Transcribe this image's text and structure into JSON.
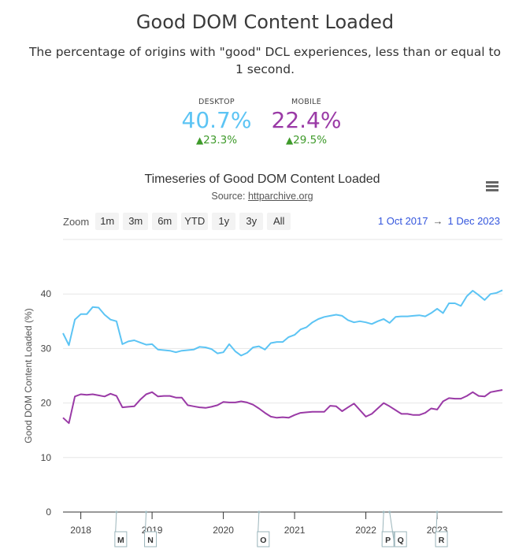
{
  "header": {
    "title": "Good DOM Content Loaded",
    "description": "The percentage of origins with \"good\" DCL experiences, less than or equal to 1 second."
  },
  "kpis": {
    "desktop": {
      "label": "DESKTOP",
      "value": "40.7%",
      "change": "23.3%",
      "change_direction": "up",
      "color": "#5cc4f4"
    },
    "mobile": {
      "label": "MOBILE",
      "value": "22.4%",
      "change": "29.5%",
      "change_direction": "up",
      "color": "#9a3aa6"
    }
  },
  "chart_header": {
    "title": "Timeseries of Good DOM Content Loaded",
    "source_prefix": "Source: ",
    "source_link": "httparchive.org",
    "menu_icon": "hamburger-menu-icon"
  },
  "zoom": {
    "label": "Zoom",
    "buttons": [
      "1m",
      "3m",
      "6m",
      "YTD",
      "1y",
      "3y",
      "All"
    ],
    "range_from": "1 Oct 2017",
    "range_arrow": "→",
    "range_to": "1 Dec 2023"
  },
  "chart_data": {
    "type": "line",
    "title": "Timeseries of Good DOM Content Loaded",
    "subtitle": "Source: httparchive.org",
    "xlabel": "",
    "ylabel": "Good DOM Content Loaded (%)",
    "ylim": [
      0,
      50
    ],
    "yticks": [
      0,
      10,
      20,
      30,
      40
    ],
    "x_start": "2017-10",
    "x_end": "2023-12",
    "x_interval": "monthly",
    "xticks": [
      "2018",
      "2019",
      "2020",
      "2021",
      "2022",
      "2023"
    ],
    "grid": true,
    "legend": "none",
    "series": [
      {
        "name": "Desktop",
        "color": "#5cc4f4",
        "values": [
          32.8,
          30.6,
          35.3,
          36.3,
          36.3,
          37.6,
          37.5,
          36.2,
          35.3,
          35.0,
          30.8,
          31.3,
          31.5,
          31.1,
          30.7,
          30.8,
          29.8,
          29.7,
          29.6,
          29.3,
          29.6,
          29.7,
          29.8,
          30.3,
          30.2,
          29.9,
          29.1,
          29.3,
          30.8,
          29.5,
          28.7,
          29.2,
          30.2,
          30.4,
          29.8,
          31.0,
          31.2,
          31.2,
          32.1,
          32.5,
          33.5,
          33.9,
          34.8,
          35.4,
          35.8,
          36.0,
          36.2,
          36.0,
          35.2,
          34.8,
          35.0,
          34.8,
          34.5,
          35.0,
          35.4,
          34.7,
          35.8,
          35.9,
          35.9,
          36.0,
          36.1,
          35.9,
          36.5,
          37.3,
          36.5,
          38.3,
          38.3,
          37.8,
          39.6,
          40.6,
          39.8,
          38.9,
          40.0,
          40.2,
          40.7
        ]
      },
      {
        "name": "Mobile",
        "color": "#9a3aa6",
        "values": [
          17.3,
          16.3,
          21.2,
          21.6,
          21.5,
          21.6,
          21.4,
          21.2,
          21.7,
          21.3,
          19.2,
          19.3,
          19.4,
          20.6,
          21.6,
          22.0,
          21.2,
          21.3,
          21.3,
          21.0,
          21.0,
          19.6,
          19.4,
          19.2,
          19.1,
          19.3,
          19.6,
          20.2,
          20.1,
          20.1,
          20.3,
          20.1,
          19.7,
          19.0,
          18.2,
          17.5,
          17.3,
          17.4,
          17.3,
          17.8,
          18.2,
          18.3,
          18.4,
          18.4,
          18.4,
          19.5,
          19.4,
          18.5,
          19.2,
          19.9,
          18.7,
          17.5,
          18.0,
          19.0,
          20.0,
          19.4,
          18.7,
          18.0,
          18.0,
          17.8,
          17.8,
          18.2,
          19.0,
          18.8,
          20.3,
          20.9,
          20.8,
          20.8,
          21.3,
          22.0,
          21.3,
          21.2,
          22.0,
          22.2,
          22.4
        ]
      }
    ],
    "annotations": [
      {
        "label": "M",
        "date": "2018-07"
      },
      {
        "label": "N",
        "date": "2018-12"
      },
      {
        "label": "O",
        "date": "2020-07"
      },
      {
        "label": "P",
        "date": "2022-04"
      },
      {
        "label": "Q",
        "date": "2022-05"
      },
      {
        "label": "R",
        "date": "2023-01"
      }
    ]
  }
}
